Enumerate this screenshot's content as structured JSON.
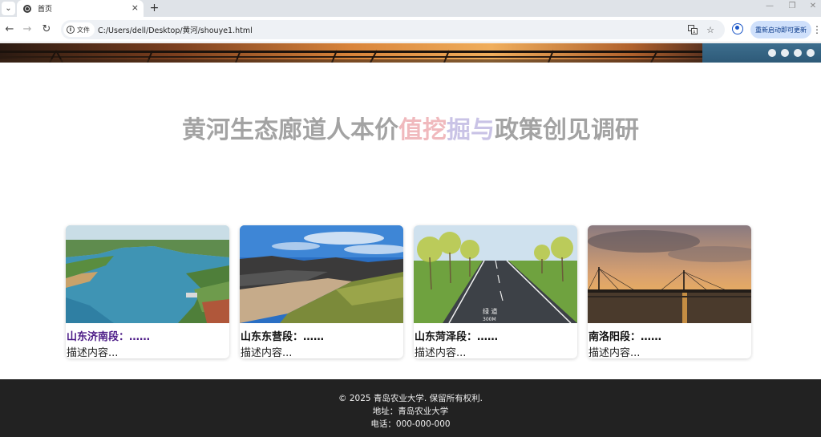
{
  "browser": {
    "tab_title": "首页",
    "tab_close": "×",
    "new_tab": "+",
    "window_controls": {
      "minimize": "—",
      "restore": "❐",
      "close": "✕"
    },
    "nav": {
      "back": "←",
      "forward": "→",
      "reload": "↻"
    },
    "site_chip_label": "文件",
    "url": "C:/Users/dell/Desktop/黄河/shouye1.html",
    "update_button": "重新启动即可更新",
    "menu": "⋮",
    "icons": [
      "tab-search-icon",
      "globe-icon",
      "info-icon",
      "translate-icon",
      "star-icon",
      "profile-icon",
      "kebab-menu-icon"
    ]
  },
  "carousel": {
    "dot_count": 4,
    "colors": {
      "dot": "#e9eef2",
      "right_panel": "#3d6e8e"
    }
  },
  "page": {
    "title_parts": {
      "part1": "黄河生态廊道人本价",
      "part2": "值挖",
      "part3": "掘与",
      "part4": "政策创见调研"
    },
    "title_colors": {
      "gray": "#a3a3a3",
      "pink": "#f0b9bd",
      "lavender": "#c9c3e6"
    }
  },
  "cards": [
    {
      "title": "山东济南段：……",
      "desc": "描述内容...",
      "visited": true,
      "image": "reservoir-aerial"
    },
    {
      "title": "山东东营段：……",
      "desc": "描述内容...",
      "visited": false,
      "image": "river-canyon"
    },
    {
      "title": "山东菏泽段：……",
      "desc": "描述内容...",
      "visited": false,
      "image": "greenway-road"
    },
    {
      "title": "南洛阳段：……",
      "desc": "描述内容...",
      "visited": false,
      "image": "bridge-sunset"
    }
  ],
  "road_marking": {
    "text1": "绿 道",
    "text2": "300M"
  },
  "footer": {
    "copyright": "© 2025 青岛农业大学. 保留所有权利.",
    "address": "地址：青岛农业大学",
    "phone": "电话：000-000-000"
  }
}
